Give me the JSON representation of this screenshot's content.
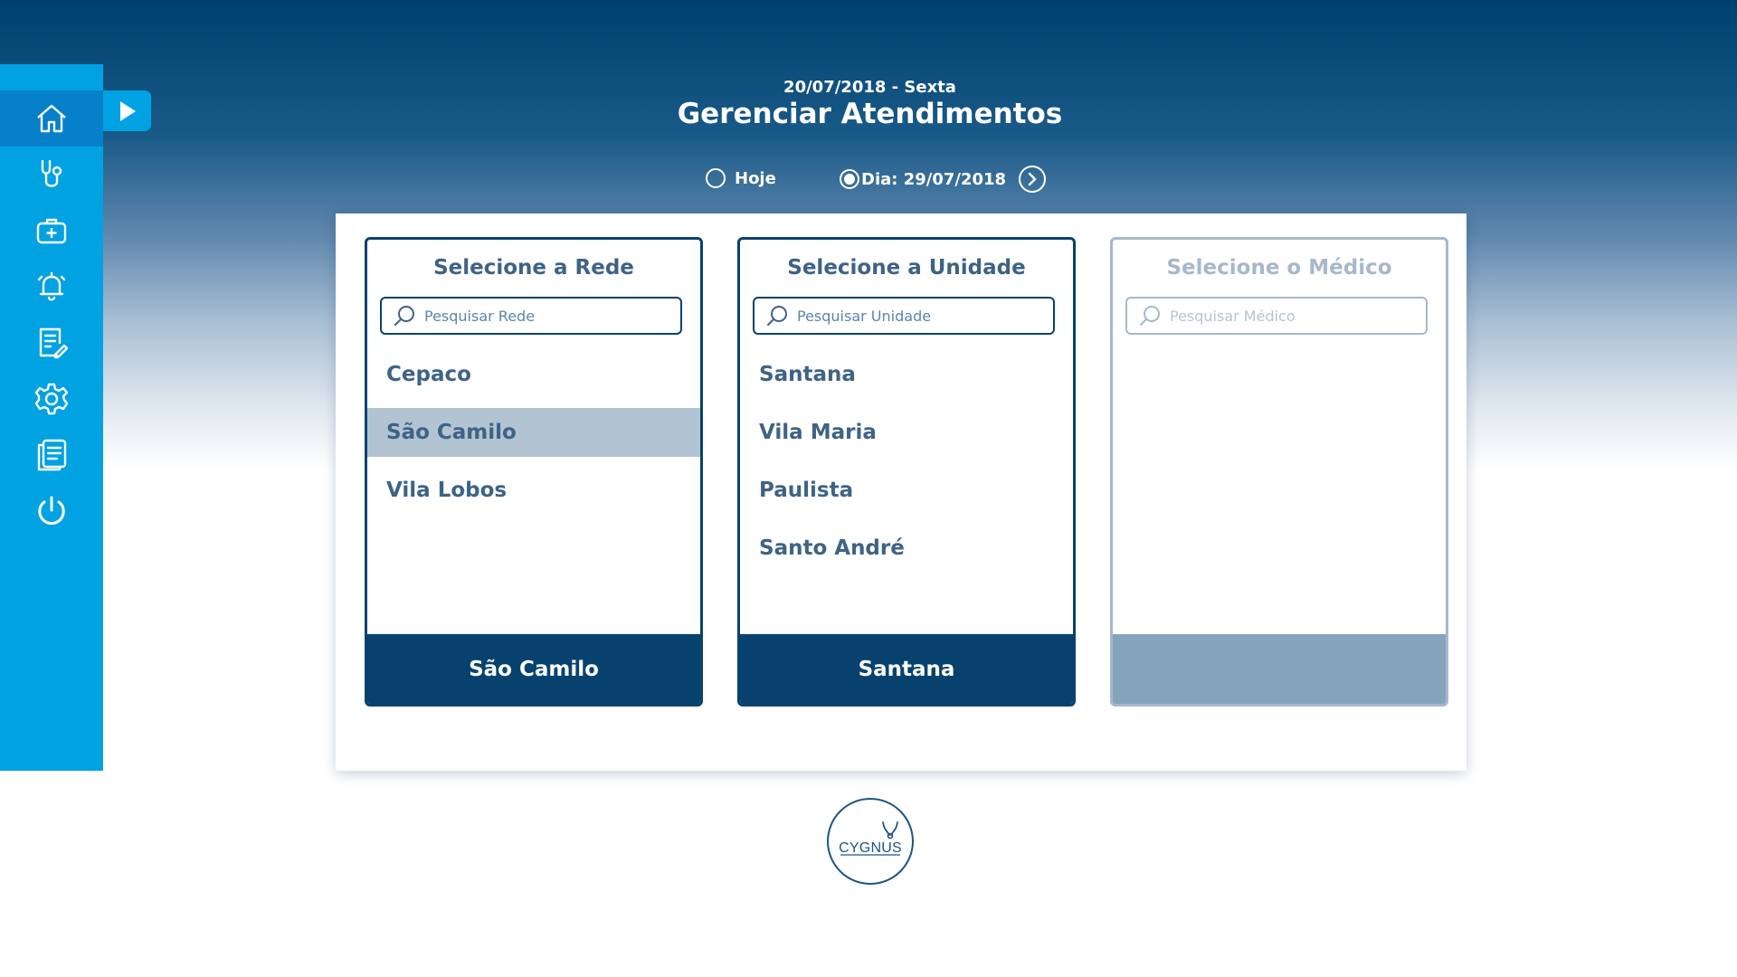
{
  "header": {
    "date": "20/07/2018 - Sexta",
    "title": "Gerenciar Atendimentos"
  },
  "day_selector": {
    "today_label": "Hoje",
    "today_selected": false,
    "day_label": "Dia: 29/07/2018",
    "day_selected": true
  },
  "sidebar": {
    "items": [
      {
        "icon": "home-icon",
        "active": true
      },
      {
        "icon": "stethoscope-icon",
        "active": false
      },
      {
        "icon": "medical-kit-icon",
        "active": false
      },
      {
        "icon": "bell-icon",
        "active": false
      },
      {
        "icon": "edit-document-icon",
        "active": false
      },
      {
        "icon": "gear-icon",
        "active": false
      },
      {
        "icon": "documents-icon",
        "active": false
      },
      {
        "icon": "power-icon",
        "active": false
      }
    ]
  },
  "panels": {
    "rede": {
      "title": "Selecione a Rede",
      "search_placeholder": "Pesquisar Rede",
      "items": [
        "Cepaco",
        "São Camilo",
        "Vila Lobos"
      ],
      "selected": "São Camilo",
      "footer": "São Camilo"
    },
    "unidade": {
      "title": "Selecione a Unidade",
      "search_placeholder": "Pesquisar Unidade",
      "items": [
        "Santana",
        "Vila Maria",
        "Paulista",
        "Santo André"
      ],
      "footer": "Santana"
    },
    "medico": {
      "title": "Selecione o Médico",
      "search_placeholder": "Pesquisar Médico",
      "items": [],
      "footer": ""
    }
  },
  "logo": {
    "text": "CYGNUS"
  },
  "colors": {
    "sidebar": "#00a2e2",
    "sidebar_active": "#0681c9",
    "navy": "#07426f",
    "text": "#3e6386",
    "selected_row": "#b2c3d2",
    "disabled": "#86a3bc"
  }
}
